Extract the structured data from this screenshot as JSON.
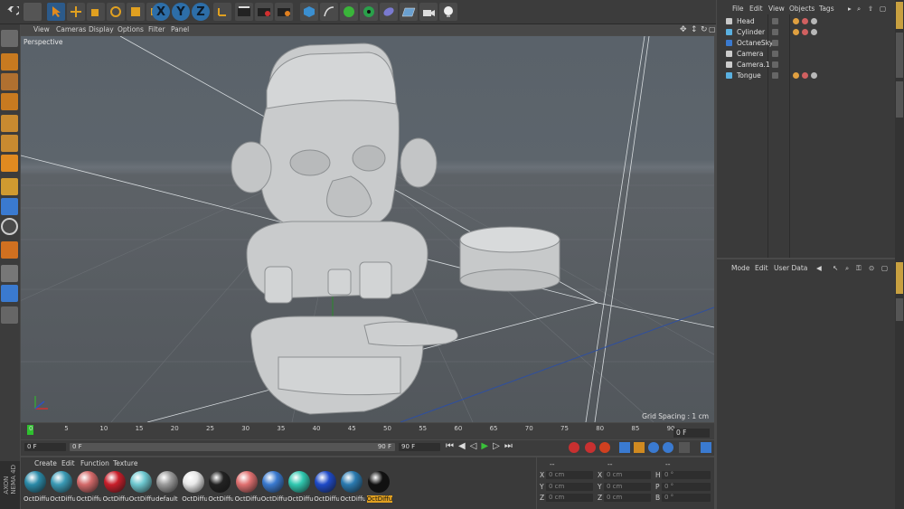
{
  "toolbar": {
    "axis_x": "X",
    "axis_y": "Y",
    "axis_z": "Z"
  },
  "viewport_menu": {
    "items": [
      "View",
      "Cameras",
      "Display",
      "Options",
      "Filter",
      "Panel"
    ],
    "label": "Perspective",
    "grid_spacing": "Grid Spacing : 1 cm"
  },
  "timeline": {
    "ticks": [
      "0",
      "5",
      "10",
      "15",
      "20",
      "25",
      "30",
      "35",
      "40",
      "45",
      "50",
      "55",
      "60",
      "65",
      "70",
      "75",
      "80",
      "85",
      "90"
    ],
    "current_frame": "0 F"
  },
  "transport": {
    "start_field": "0 F",
    "range_start": "0 F",
    "range_end": "90 F",
    "end_field": "90 F"
  },
  "material_menu": [
    "Create",
    "Edit",
    "Function",
    "Texture"
  ],
  "materials": [
    {
      "name": "OctDiffu",
      "color": "#2a8aa8"
    },
    {
      "name": "OctDiffu",
      "color": "#3a9ab5"
    },
    {
      "name": "OctDiffu",
      "color": "#d46a6a"
    },
    {
      "name": "OctDiffu",
      "color": "#c81e2a"
    },
    {
      "name": "OctDiffu",
      "color": "#6ec8d0"
    },
    {
      "name": "default",
      "color": "#9a9a9a"
    },
    {
      "name": "OctDiffu",
      "color": "#e8e8e8"
    },
    {
      "name": "OctDiffu",
      "color": "#222222"
    },
    {
      "name": "OctDiffu",
      "color": "#e07070"
    },
    {
      "name": "OctDiffu",
      "color": "#3a7ad0"
    },
    {
      "name": "OctDiffu",
      "color": "#30c8b0"
    },
    {
      "name": "OctDiffu",
      "color": "#1e4ac8"
    },
    {
      "name": "OctDiffu",
      "color": "#2a7ab0"
    },
    {
      "name": "OctDiffu",
      "color": "#111111"
    }
  ],
  "selected_material_label": "OctDiffu",
  "coordinates": {
    "header_left": "--",
    "header_mid": "--",
    "header_right": "--",
    "rows": [
      {
        "axis": "X",
        "pos": "0 cm",
        "size_axis": "X",
        "size": "0 cm",
        "rot_axis": "H",
        "rot": "0 °"
      },
      {
        "axis": "Y",
        "pos": "0 cm",
        "size_axis": "Y",
        "size": "0 cm",
        "rot_axis": "P",
        "rot": "0 °"
      },
      {
        "axis": "Z",
        "pos": "0 cm",
        "size_axis": "Z",
        "size": "0 cm",
        "rot_axis": "B",
        "rot": "0 °"
      }
    ]
  },
  "object_manager": {
    "menu": [
      "File",
      "Edit",
      "View",
      "Objects",
      "Tags"
    ],
    "objects": [
      "Head",
      "Cylinder",
      "OctaneSky",
      "Camera",
      "Camera.1",
      "Tongue"
    ]
  },
  "attribute_manager": {
    "menu": [
      "Mode",
      "Edit",
      "User Data"
    ]
  },
  "brand": "AXON\nNEMA 4D"
}
